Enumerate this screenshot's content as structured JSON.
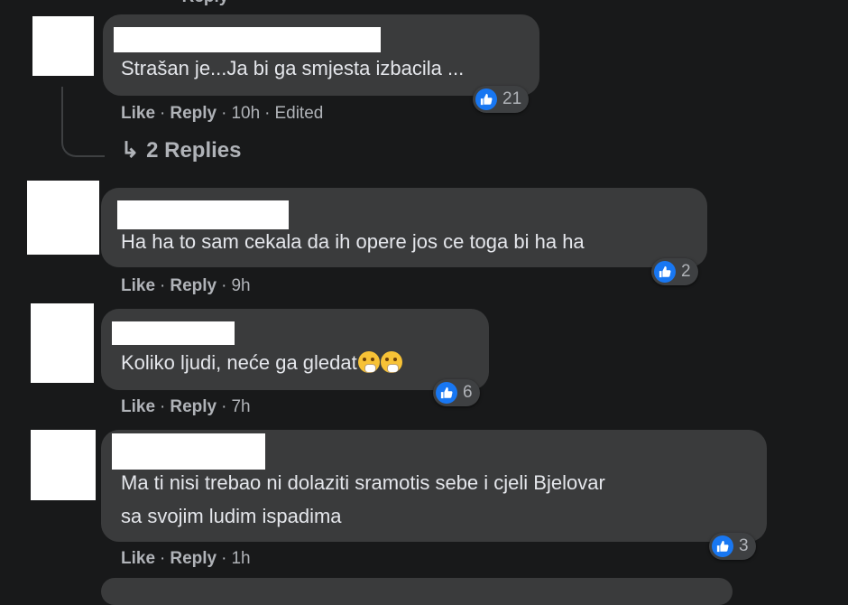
{
  "top_partial": "· Reply",
  "comments": [
    {
      "text": "Strašan je...Ja bi ga smjesta izbacila ...",
      "like": "Like",
      "reply": "Reply",
      "time": "10h",
      "edited": "Edited",
      "reactions": "21",
      "replies": "2 Replies"
    },
    {
      "text": "Ha ha to sam cekala da ih opere jos ce toga bi ha ha",
      "like": "Like",
      "reply": "Reply",
      "time": "9h",
      "reactions": "2"
    },
    {
      "text": "Koliko ljudi, neće ga gledat",
      "like": "Like",
      "reply": "Reply",
      "time": "7h",
      "reactions": "6"
    },
    {
      "text_line1": "Ma ti nisi trebao ni dolaziti sramotis sebe i cjeli Bjelovar",
      "text_line2": "sa svojim ludim ispadima",
      "like": "Like",
      "reply": "Reply",
      "time": "1h",
      "reactions": "3"
    }
  ],
  "colors": {
    "background": "#18191a",
    "bubble": "#3a3b3c",
    "like_blue": "#1877f2"
  },
  "icons": {
    "reaction": "like-thumb-icon",
    "replies": "reply-arrow-icon",
    "emoji": "grimacing-emoji-icon"
  }
}
